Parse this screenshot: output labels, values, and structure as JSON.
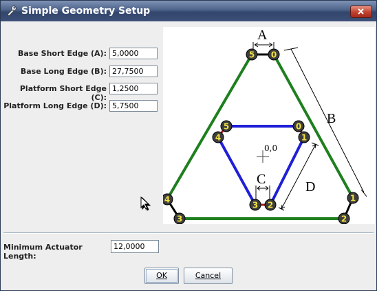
{
  "window": {
    "title": "Simple Geometry Setup"
  },
  "fields": [
    {
      "label": "Base Short Edge (A):",
      "value": "5,0000"
    },
    {
      "label": "Base Long Edge (B):",
      "value": "27,7500"
    },
    {
      "label": "Platform Short Edge (C):",
      "value": "1,2500"
    },
    {
      "label": "Platform Long Edge (D):",
      "value": "5,7500"
    }
  ],
  "min_actuator": {
    "label": "Minimum Actuator Length:",
    "value": "12,0000"
  },
  "diagram": {
    "edge_labels": {
      "a": "A",
      "b": "B",
      "c": "C",
      "d": "D"
    },
    "origin_label": "0,0",
    "base_joints": [
      "0",
      "1",
      "2",
      "3",
      "4",
      "5"
    ],
    "platform_joints": [
      "0",
      "1",
      "2",
      "3",
      "4",
      "5"
    ],
    "colors": {
      "base": "#1e7f1e",
      "platform": "#1f1fd8",
      "joint_fill": "#3d3d3d",
      "joint_text": "#f0e040",
      "actuator": "#b01818"
    }
  },
  "buttons": {
    "ok": "OK",
    "cancel": "Cancel"
  }
}
